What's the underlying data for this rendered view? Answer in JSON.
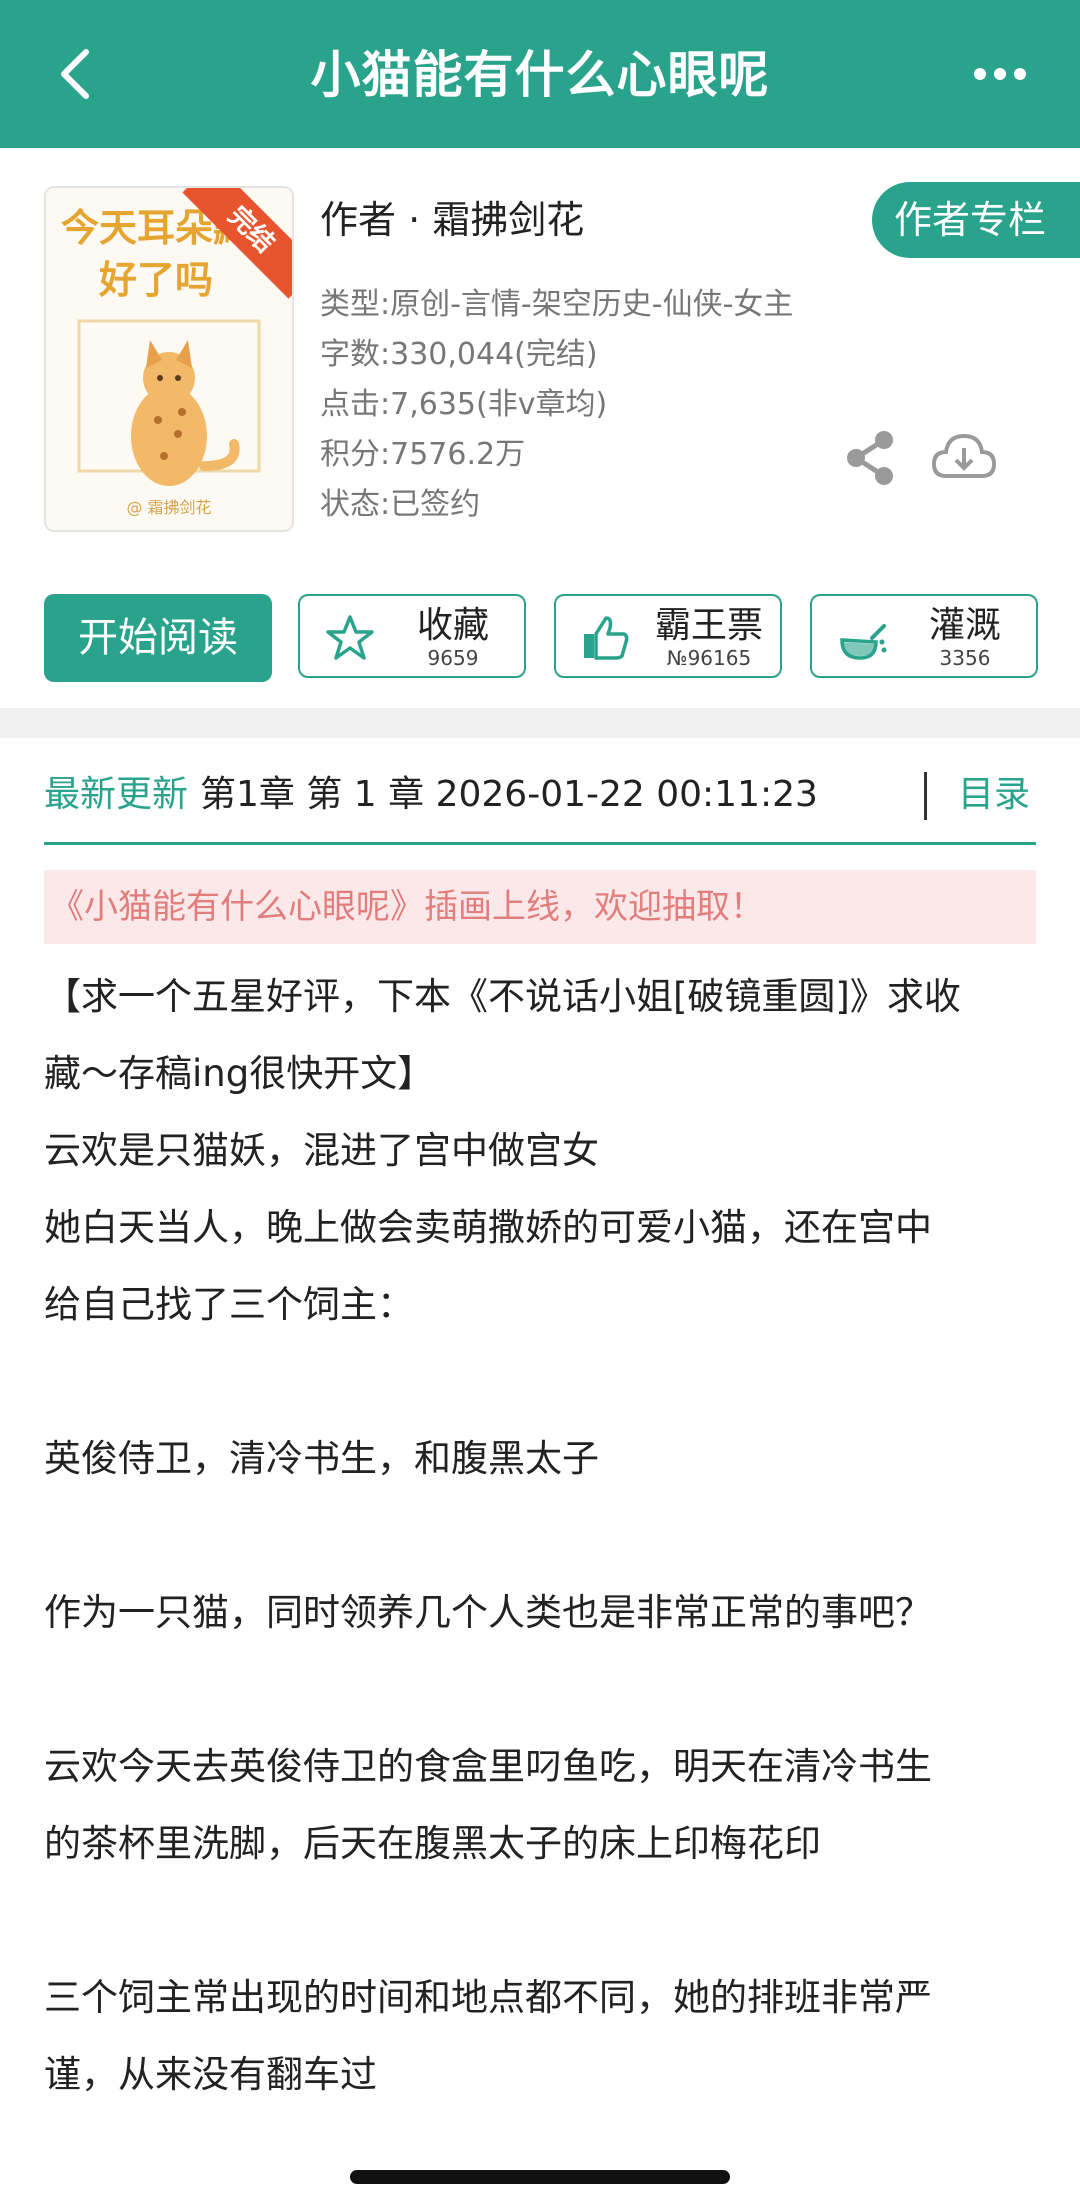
{
  "header": {
    "title": "小猫能有什么心眼呢",
    "back_icon": "chevron-left-icon",
    "more_icon": "more-horizontal-icon"
  },
  "colors": {
    "accent": "#2aa38c",
    "notice_bg": "#fbe9ea",
    "notice_text": "#e27d7e"
  },
  "book": {
    "cover": {
      "title": "今天耳朵藏好了吗",
      "badge": "完结",
      "author_mark": "@ 霜拂剑花"
    },
    "author_line": "作者 · 霜拂剑花",
    "author_column_button": "作者专栏",
    "meta": {
      "type": "类型:原创-言情-架空历史-仙侠-女主",
      "words": "字数:330,044(完结)",
      "clicks": "点击:7,635(非v章均)",
      "score": "积分:7576.2万",
      "status": "状态:已签约"
    },
    "share_icon": "share-icon",
    "download_icon": "cloud-download-icon"
  },
  "actions": {
    "read": "开始阅读",
    "collect": {
      "label": "收藏",
      "count": "9659",
      "icon": "star-icon"
    },
    "bawang": {
      "label": "霸王票",
      "count": "№96165",
      "icon": "thumbs-up-icon"
    },
    "water": {
      "label": "灌溉",
      "count": "3356",
      "icon": "watering-can-icon"
    }
  },
  "update": {
    "label": "最新更新",
    "text": "第1章 第 1 章 2026-01-22 00:11:23",
    "toc": "目录"
  },
  "notice": "《小猫能有什么心眼呢》插画上线，欢迎抽取！",
  "description": [
    "【求一个五星好评，下本《不说话小姐[破镜重圆]》求收",
    "藏～存稿ing很快开文】",
    "云欢是只猫妖，混进了宫中做宫女",
    "她白天当人，晚上做会卖萌撒娇的可爱小猫，还在宫中",
    "给自己找了三个饲主：",
    "",
    "英俊侍卫，清冷书生，和腹黑太子",
    "",
    "作为一只猫，同时领养几个人类也是非常正常的事吧？",
    "",
    "云欢今天去英俊侍卫的食盒里叼鱼吃，明天在清冷书生",
    "的茶杯里洗脚，后天在腹黑太子的床上印梅花印",
    "",
    "三个饲主常出现的时间和地点都不同，她的排班非常严",
    "谨，从来没有翻车过"
  ]
}
